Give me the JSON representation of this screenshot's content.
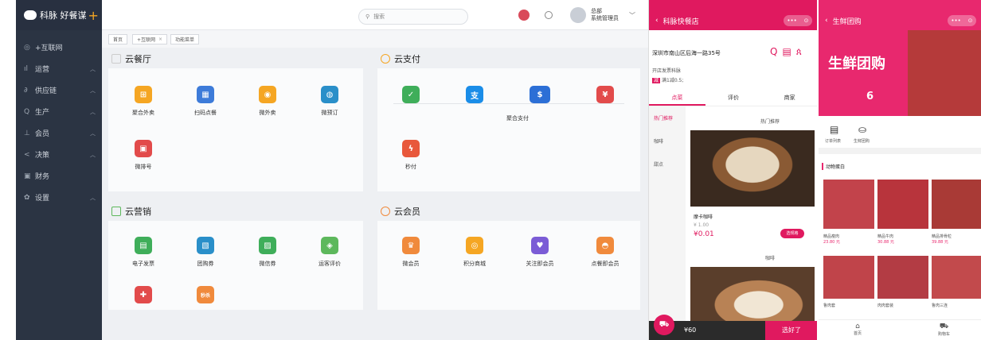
{
  "sidebar": {
    "brand": "科脉 好餐谋",
    "items": [
      {
        "label": "+互联网",
        "icon": "globe-icon"
      },
      {
        "label": "运营",
        "icon": "chart-icon"
      },
      {
        "label": "供应链",
        "icon": "link-icon"
      },
      {
        "label": "生产",
        "icon": "search-icon"
      },
      {
        "label": "会员",
        "icon": "user-icon"
      },
      {
        "label": "决策",
        "icon": "share-icon"
      },
      {
        "label": "财务",
        "icon": "calendar-icon"
      },
      {
        "label": "设置",
        "icon": "gear-icon"
      }
    ]
  },
  "topbar": {
    "search_placeholder": "搜索",
    "user_name": "总部",
    "user_role": "系统管理员"
  },
  "tabs": [
    "首页",
    "+互联网",
    "功能菜单"
  ],
  "sections": {
    "canteen": {
      "title": "云餐厅",
      "apps": [
        {
          "label": "聚合外卖",
          "color": "#f5a623"
        },
        {
          "label": "扫码点餐",
          "color": "#3d7bd9"
        },
        {
          "label": "微外卖",
          "color": "#f5a623"
        },
        {
          "label": "微预订",
          "color": "#2a8fc9"
        },
        {
          "label": "微排号",
          "color": "#e24b4b"
        }
      ]
    },
    "pay": {
      "title": "云支付",
      "aggregate_label": "聚合支付",
      "apps": [
        {
          "label": "",
          "color": "#3fae5a"
        },
        {
          "label": "",
          "color": "#1a8de8"
        },
        {
          "label": "",
          "color": "#2c6fd6"
        },
        {
          "label": "",
          "color": "#e24b4b"
        },
        {
          "label": "秒付",
          "color": "#e8583b"
        }
      ]
    },
    "marketing": {
      "title": "云营销",
      "apps": [
        {
          "label": "电子发票",
          "color": "#3fae5a"
        },
        {
          "label": "团购券",
          "color": "#2a8fc9"
        },
        {
          "label": "微信券",
          "color": "#3fae5a"
        },
        {
          "label": "运客评价",
          "color": "#5db85c"
        },
        {
          "label": "",
          "color": "#e24b4b"
        },
        {
          "label": "秒杀",
          "color": "#f08a3c"
        }
      ]
    },
    "member": {
      "title": "云会员",
      "apps": [
        {
          "label": "微会员",
          "color": "#f08a3c"
        },
        {
          "label": "积分商城",
          "color": "#f5a623"
        },
        {
          "label": "关注即会员",
          "color": "#7b5cd6"
        },
        {
          "label": "点餐即会员",
          "color": "#f08a3c"
        }
      ]
    }
  },
  "phone1": {
    "title": "科脉快餐店",
    "address": "深圳市南山区后海一路35号",
    "invoice_text": "开店发票科脉",
    "promo_text": "满1减0.5;",
    "tabs": [
      "点菜",
      "评价",
      "商家"
    ],
    "hot_label": "热门推荐",
    "side_items": [
      "热门推荐",
      "咖啡",
      "甜点"
    ],
    "item_name": "摩卡咖啡",
    "item_orig": "¥ 1.00",
    "item_price": "¥0.01",
    "add_label": "选规格",
    "coffee_label": "咖啡",
    "total": "¥60",
    "checkout": "选好了",
    "accent": "#e0195f"
  },
  "phone2": {
    "title": "生鲜团购",
    "banner": "生鲜团购",
    "banner_num": "6",
    "icons": [
      "订单列表",
      "生鲜团购"
    ],
    "category": "动物蛋白",
    "products": [
      {
        "name": "精品瘦肉",
        "price": "23.80 元"
      },
      {
        "name": "精品牛肉",
        "price": "30.88 元"
      },
      {
        "name": "精品排骨粒",
        "price": "39.88 元"
      },
      {
        "name": "鲁肉套",
        "price": ""
      },
      {
        "name": "肉肉套装",
        "price": ""
      },
      {
        "name": "鲁肉三连",
        "price": ""
      }
    ],
    "nav": [
      "首页",
      "购物车"
    ],
    "accent": "#e8286e"
  }
}
